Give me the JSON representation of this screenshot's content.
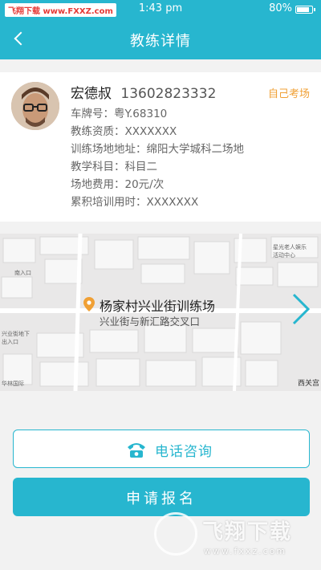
{
  "status_bar": {
    "watermark_site": "飞翔下载",
    "watermark_url": "www.FXXZ.com",
    "time": "1:43 pm",
    "battery": "80%"
  },
  "header": {
    "title": "教练详情"
  },
  "coach": {
    "name": "宏德叔",
    "phone": "13602823332",
    "tag": "自己考场",
    "details": [
      "车牌号：粤Y.68310",
      "教练资质：XXXXXXX",
      "训练场地地址：绵阳大学城科二场地",
      "教学科目：科目二",
      "场地费用：20元/次",
      "累积培训用时：XXXXXXX"
    ]
  },
  "location": {
    "name": "杨家村兴业街训练场",
    "address": "兴业街与新汇路交叉口",
    "map_labels": [
      "西关宫",
      "南入口",
      "兴业街地下出入口",
      "华林国际",
      "星光老人娱乐活动中心"
    ]
  },
  "actions": {
    "call_label": "电话咨询",
    "apply_label": "申请报名"
  },
  "watermark": {
    "brand": "飞翔下载",
    "url": "www.fxxz.com"
  },
  "colors": {
    "primary": "#27b6cf",
    "tag": "#f0a035",
    "pin": "#f0a035"
  }
}
